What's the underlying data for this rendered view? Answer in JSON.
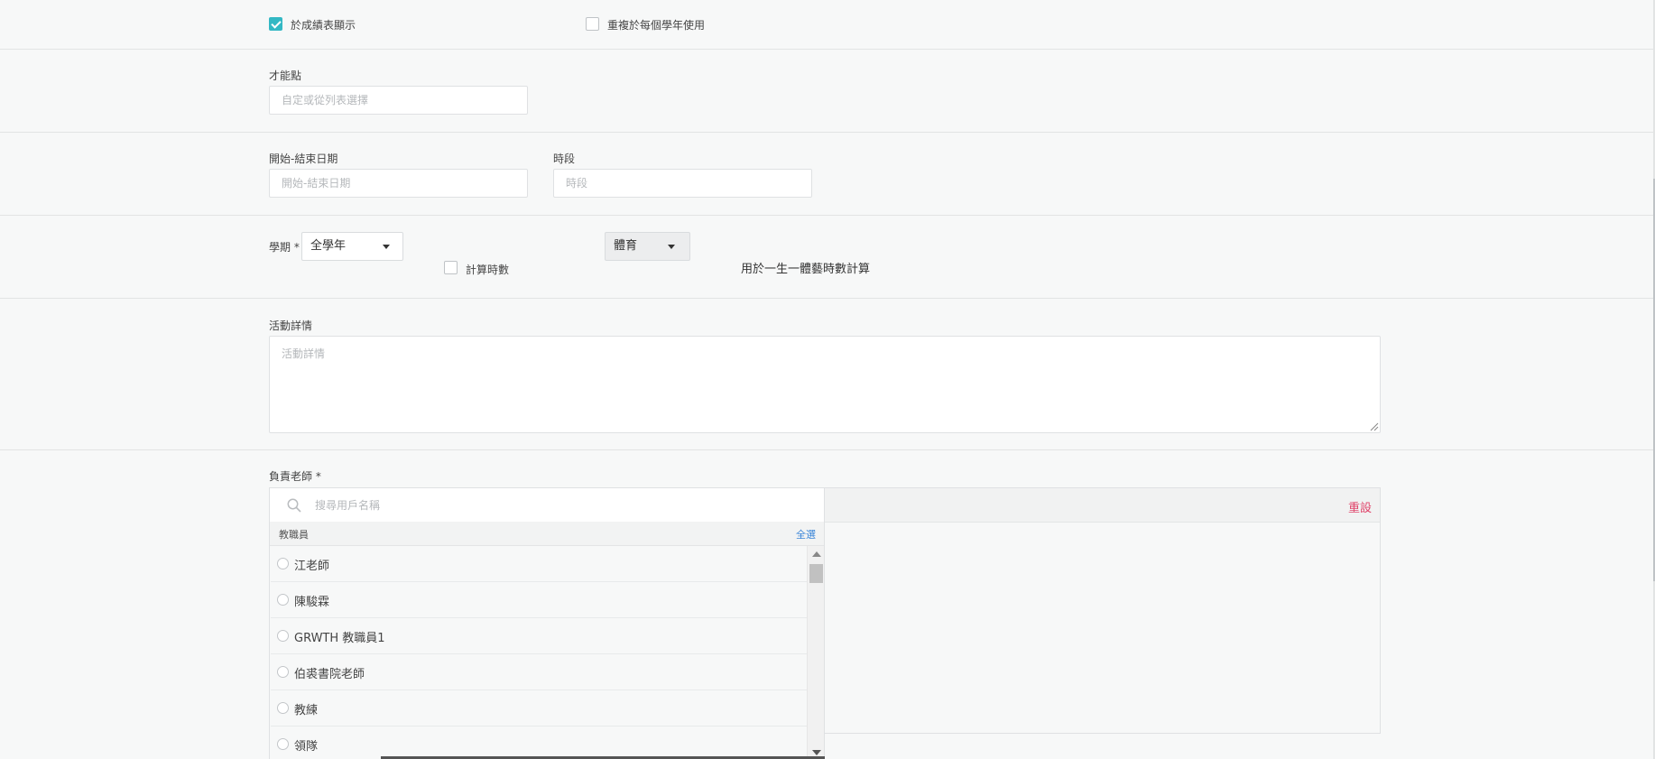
{
  "options": {
    "show_in_report": {
      "label": "於成績表顯示",
      "checked": true
    },
    "repeat_each_year": {
      "label": "重複於每個學年使用",
      "checked": false
    }
  },
  "talent": {
    "label": "才能點",
    "placeholder": "自定或從列表選擇"
  },
  "date_range": {
    "label": "開始-結束日期",
    "placeholder": "開始-結束日期"
  },
  "time_slot": {
    "label": "時段",
    "placeholder": "時段"
  },
  "semester": {
    "label": "學期",
    "required_mark": "*",
    "value": "全學年",
    "count_hours": {
      "label": "計算時數",
      "checked": false
    },
    "category_value": "體育",
    "note": "用於一生一體藝時數計算"
  },
  "details": {
    "label": "活動詳情",
    "placeholder": "活動詳情"
  },
  "teacher": {
    "label": "負責老師",
    "required_mark": "*",
    "search_placeholder": "搜尋用戶名稱",
    "group_label": "教職員",
    "select_all": "全選",
    "reset": "重設",
    "items": [
      {
        "name": "江老師"
      },
      {
        "name": "陳駿霖"
      },
      {
        "name": "GRWTH 教職員1"
      },
      {
        "name": "伯裘書院老師"
      },
      {
        "name": "教練"
      },
      {
        "name": "領隊"
      }
    ]
  },
  "colors": {
    "accent": "#33b8c4",
    "link": "#3a85d8",
    "danger": "#e0456b"
  }
}
